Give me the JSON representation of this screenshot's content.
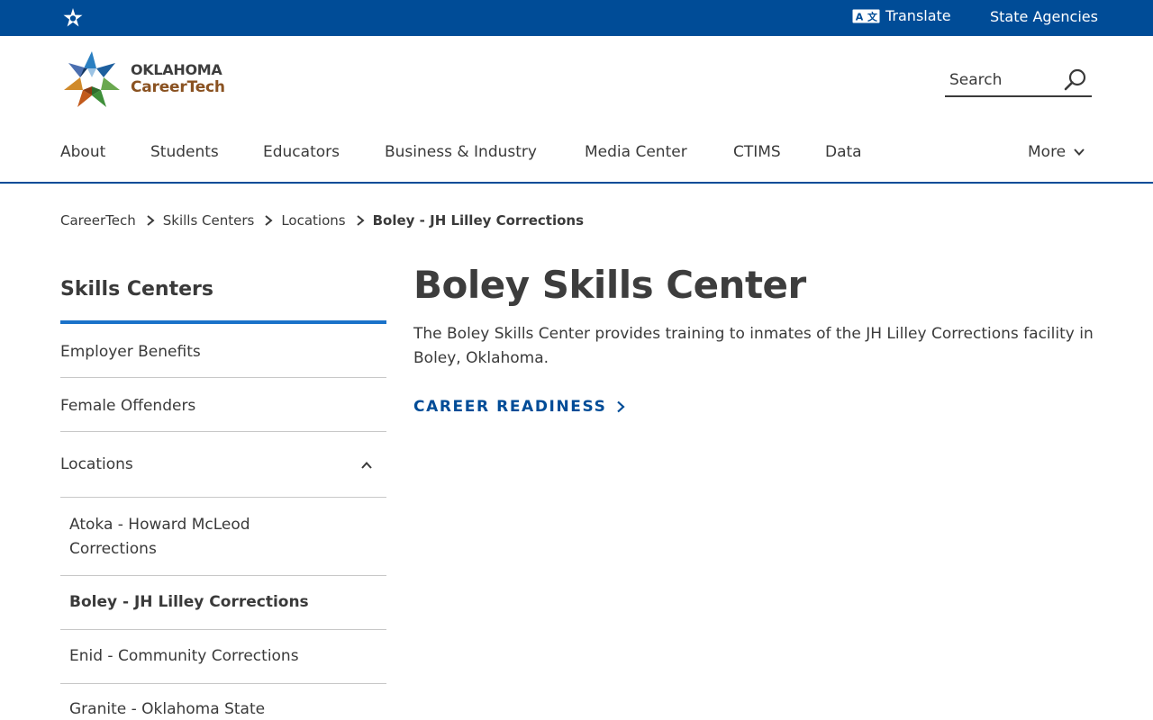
{
  "topbar": {
    "translate_label": "Translate",
    "agencies_label": "State Agencies"
  },
  "logo": {
    "line1": "OKLAHOMA",
    "line2": "CareerTech"
  },
  "search": {
    "placeholder": "Search"
  },
  "nav": {
    "items": [
      "About",
      "Students",
      "Educators",
      "Business & Industry",
      "Media Center",
      "CTIMS",
      "Data"
    ],
    "more_label": "More"
  },
  "breadcrumb": {
    "items": [
      "CareerTech",
      "Skills Centers",
      "Locations"
    ],
    "current": "Boley - JH Lilley Corrections"
  },
  "sidebar": {
    "title": "Skills Centers",
    "items": [
      "Employer Benefits",
      "Female Offenders",
      "Locations"
    ],
    "subitems": [
      "Atoka - Howard McLeod Corrections",
      "Boley - JH Lilley Corrections",
      "Enid - Community Corrections",
      "Granite - Oklahoma State"
    ]
  },
  "main": {
    "title": "Boley Skills Center",
    "intro": "The Boley Skills Center provides training to inmates of the JH Lilley Corrections facility in Boley, Oklahoma.",
    "link_label": "CAREER READINESS"
  },
  "colors": {
    "brand_blue": "#004c97",
    "sidebar_accent": "#1a72c9",
    "logo_brown": "#8a5221"
  }
}
